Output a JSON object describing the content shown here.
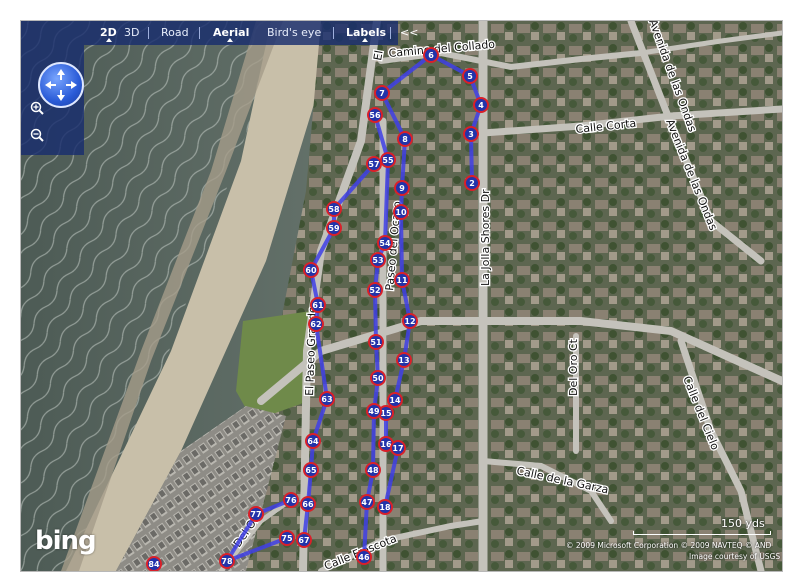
{
  "toolbar": {
    "view_2d": "2D",
    "view_3d": "3D",
    "road": "Road",
    "aerial": "Aerial",
    "birds_eye": "Bird's eye",
    "labels": "Labels",
    "collapse": "<<"
  },
  "streets": {
    "camino_del_collado": "Camino del Collado",
    "el_camino": "El",
    "calle_corta": "Calle Corta",
    "avenida_de_las_ondas_1": "Avenida de las Ondas",
    "avenida_de_las_ondas_2": "Avenida de las Ondas",
    "la_jolla_shores_dr": "La Jolla Shores Dr",
    "paseo_del_ocaso": "Paseo del Ocaso",
    "el_paseo_grande": "El Paseo Grande",
    "del_oro_ct": "Del Oro Ct",
    "calle_del_cielo": "Calle del Cielo",
    "calle_de_la_garza": "Calle de la Garza",
    "del_oro": "Del Oro",
    "calle_frescota": "Calle Frescota"
  },
  "scale_label": "150 yds",
  "copyright": "© 2009 Microsoft Corporation   © 2009 NAVTEQ   © AND",
  "image_credit": "Image courtesy of USGS",
  "brand": "bing",
  "colors": {
    "route": "#3f3fe6",
    "marker_fill": "#2233aa",
    "marker_ring": "#d9202a",
    "toolbar_bg": "#192d6e"
  },
  "route_a": [
    {
      "n": "2"
    },
    {
      "n": "3"
    },
    {
      "n": "4"
    },
    {
      "n": "5"
    },
    {
      "n": "6"
    },
    {
      "n": "7"
    },
    {
      "n": "8"
    },
    {
      "n": "9"
    },
    {
      "n": "10"
    },
    {
      "n": "11"
    },
    {
      "n": "12"
    },
    {
      "n": "13"
    },
    {
      "n": "14"
    },
    {
      "n": "15"
    },
    {
      "n": "16"
    },
    {
      "n": "17"
    },
    {
      "n": "18"
    }
  ],
  "route_b": [
    {
      "n": "56"
    },
    {
      "n": "55"
    },
    {
      "n": "54"
    },
    {
      "n": "53"
    },
    {
      "n": "52"
    },
    {
      "n": "51"
    },
    {
      "n": "50"
    },
    {
      "n": "49"
    },
    {
      "n": "48"
    },
    {
      "n": "47"
    },
    {
      "n": "46"
    }
  ],
  "route_c": [
    {
      "n": "57"
    },
    {
      "n": "58"
    },
    {
      "n": "59"
    },
    {
      "n": "60"
    },
    {
      "n": "61"
    },
    {
      "n": "62"
    },
    {
      "n": "63"
    },
    {
      "n": "64"
    },
    {
      "n": "65"
    },
    {
      "n": "66"
    },
    {
      "n": "67"
    }
  ],
  "route_d": [
    {
      "n": "76"
    },
    {
      "n": "77"
    },
    {
      "n": "78"
    },
    {
      "n": "75"
    }
  ],
  "extra_markers": [
    {
      "n": "84"
    }
  ]
}
